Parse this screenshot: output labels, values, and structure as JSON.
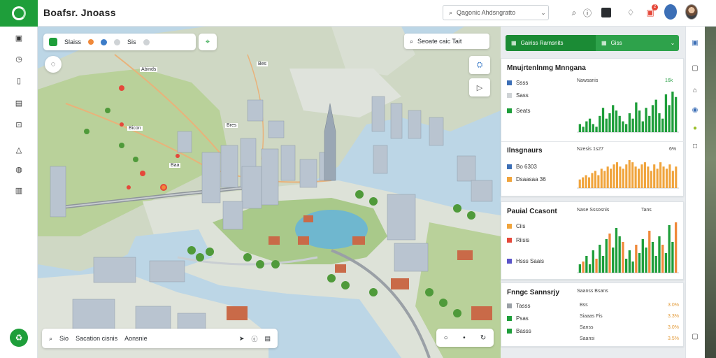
{
  "app": {
    "title": "Boafsr. Jnoass",
    "logo_icon": "leaf-ring-logo-icon",
    "accent_color": "#1e9e3a"
  },
  "header": {
    "search_placeholder": "Qagonic Ahdsngratto",
    "search_icon": "search-icon",
    "icons": [
      "search-icon",
      "info-icon",
      "dark-square-icon",
      "bell-icon",
      "gift-icon",
      "user-avatar-icon",
      "profile-photo"
    ],
    "notification_count": "2"
  },
  "left_sidebar": {
    "items": [
      {
        "icon": "image-icon",
        "glyph": "▣"
      },
      {
        "icon": "clock-icon",
        "glyph": "◷"
      },
      {
        "icon": "bookmark-icon",
        "glyph": "▯"
      },
      {
        "icon": "map-icon",
        "glyph": "▤"
      },
      {
        "icon": "chat-icon",
        "glyph": "⊡"
      },
      {
        "icon": "warning-icon",
        "glyph": "△"
      },
      {
        "icon": "globe-icon",
        "glyph": "◍"
      },
      {
        "icon": "library-icon",
        "glyph": "▥"
      }
    ],
    "bottom_button_icon": "recycle-icon"
  },
  "map": {
    "toolbar": {
      "label_1": "Slaiss",
      "label_2": "Sis"
    },
    "pin_button_icon": "location-pin-icon",
    "round_button_icon": "compass-icon",
    "search2": {
      "text": "Seoate caic Tait"
    },
    "side_buttons": [
      "layers-icon",
      "navigation-arrow-icon"
    ],
    "labels": [
      "Abinds",
      "Bes",
      "Bres",
      "Bicon",
      "Baa"
    ],
    "bottom_bar": {
      "text_1": "Sio",
      "text_2": "Sacation cisnis",
      "text_3": "Aonsnie"
    },
    "zoom": {
      "minus": "•",
      "label": "•"
    }
  },
  "right_panel": {
    "dropdown": {
      "left_label": "Gairiss Rarnsnits",
      "right_label": "Giss"
    },
    "cards": [
      {
        "title": "Mnujrtenlnmg Mnngana",
        "legend": [
          {
            "label": "Ssss",
            "color": "#3c6fb6"
          },
          {
            "label": "Sass",
            "color": "#2ea24b"
          },
          {
            "label": "Seats",
            "color": "#1e9e3a"
          }
        ],
        "chart_title": "Nawsanis",
        "chart_tag": "16k"
      },
      {
        "title": "Ilnsgnaurs",
        "legend": [
          {
            "label": "Bo 6303",
            "color": "#3c6fb6"
          },
          {
            "label": "Dsaasaa 36",
            "color": "#f0a43c"
          }
        ],
        "chart_title": "Nzesis 1s27",
        "chart_tag": "6%"
      },
      {
        "title": "Pauial Ccasont",
        "legend": [
          {
            "label": "Ciis",
            "color": "#f0a43c"
          },
          {
            "label": "Riisis",
            "color": "#e5483a"
          },
          {
            "label": "Hsss Saais",
            "color": "#5a54c9"
          }
        ],
        "chart_title": "Nase Sssosnis",
        "chart_tag": "Tans"
      },
      {
        "title": "Fnngc Sannsrjy",
        "legend": [
          {
            "label": "Tasss",
            "color": "#9aa0a6"
          },
          {
            "label": "Psas",
            "color": "#1e9e3a"
          },
          {
            "label": "Basss",
            "color": "#1e9e3a"
          }
        ],
        "chart_title": "Saanss Bsans",
        "rows": [
          {
            "label": "Bss",
            "value": "3.0%"
          },
          {
            "label": "Siaaas Fis",
            "value": "3.3%"
          },
          {
            "label": "Sanss",
            "value": "3.0%"
          },
          {
            "label": "Saansi",
            "value": "3.5%"
          }
        ]
      }
    ]
  },
  "chart_data": [
    {
      "type": "bar",
      "title": "Nawsanis",
      "series": [
        {
          "name": "",
          "values": [
            3,
            2,
            4,
            5,
            3,
            2,
            6,
            9,
            5,
            7,
            10,
            8,
            6,
            4,
            3,
            7,
            5,
            11,
            8,
            4,
            9,
            6,
            10,
            12,
            7,
            5,
            14,
            10,
            15,
            13
          ]
        }
      ],
      "colors": [
        "#1e9e3a"
      ]
    },
    {
      "type": "bar",
      "title": "Nzesis 1s27",
      "series": [
        {
          "name": "",
          "values": [
            4,
            5,
            6,
            5,
            7,
            8,
            6,
            9,
            8,
            10,
            9,
            11,
            12,
            10,
            9,
            11,
            13,
            12,
            10,
            9,
            11,
            12,
            10,
            8,
            11,
            9,
            12,
            10,
            9,
            11,
            8,
            10
          ]
        }
      ],
      "colors": [
        "#f0a43c"
      ]
    },
    {
      "type": "bar",
      "title": "Nase Sssosnis",
      "series": [
        {
          "name": "",
          "values": [
            3,
            4,
            6,
            3,
            8,
            5,
            10,
            6,
            12,
            14,
            9,
            16,
            13,
            11,
            5,
            8,
            4,
            10,
            7,
            12,
            9,
            15,
            11,
            6,
            13,
            10,
            7,
            17,
            11,
            18
          ]
        }
      ],
      "colors": [
        "#1e9e3a",
        "#f0893a"
      ]
    }
  ]
}
